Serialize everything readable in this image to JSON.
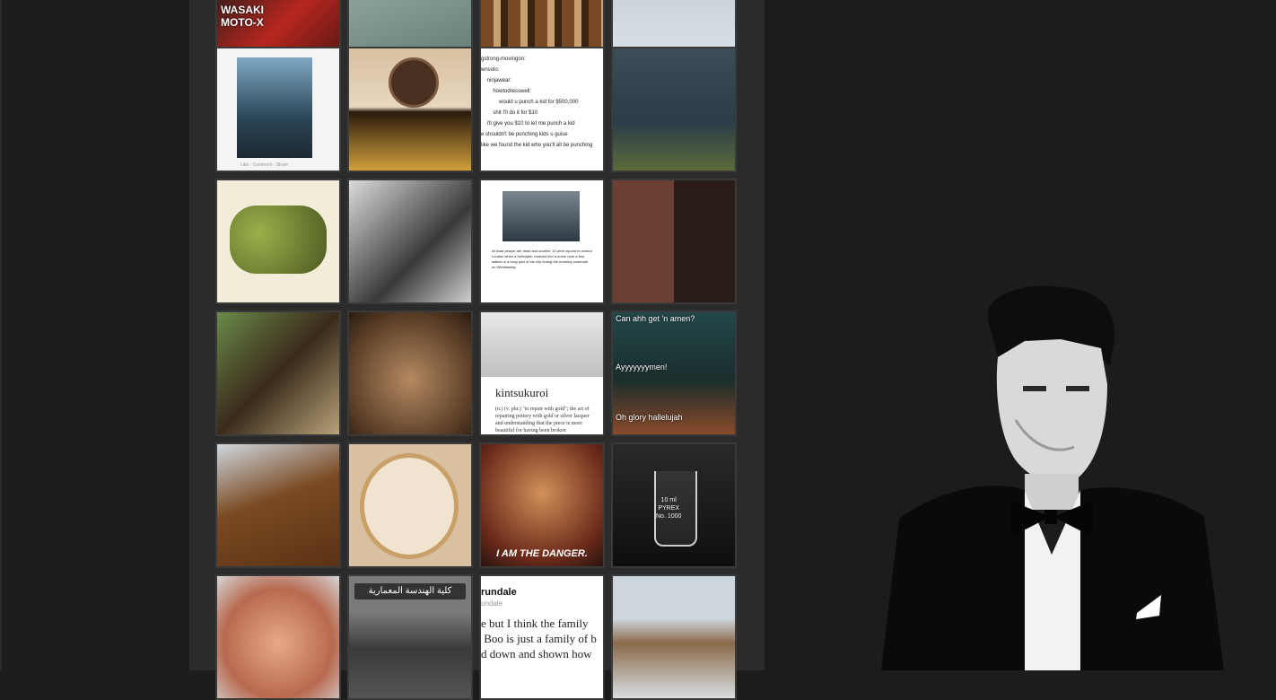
{
  "tiles": [
    {
      "id": "moto-x",
      "label": "WASAKI\nMOTO-X"
    },
    {
      "id": "water-stones",
      "label": ""
    },
    {
      "id": "rings-wood",
      "label": ""
    },
    {
      "id": "geese-sky",
      "label": ""
    },
    {
      "id": "police-car",
      "label": "Like · Comment · Share"
    },
    {
      "id": "angry-bird",
      "label": ""
    },
    {
      "id": "tumblr-text",
      "label": "gstrong-movingon:\nwnsolo:\n    ninjawear:\n        howtodresswell:\n            would u punch a kid for $500,000\n        shit I'll do it for $10\n    i'll give you $10 to let me punch a kid\ne shouldn't be punching kids u guise\nlike we found the kid who you'll all be punching"
    },
    {
      "id": "lake-aerial",
      "label": ""
    },
    {
      "id": "zelda-controller",
      "label": ""
    },
    {
      "id": "bw-portrait",
      "label": ""
    },
    {
      "id": "news-article",
      "label": "At least people are dead and another 13 were injured in central London when a helicopter crashed into a crane near a bus station in a busy part of the city during the morning commute on Wednesday."
    },
    {
      "id": "picard-facepalm",
      "label": ""
    },
    {
      "id": "dog-woman",
      "label": ""
    },
    {
      "id": "kitten",
      "label": ""
    },
    {
      "id": "kintsukuroi",
      "title": "kintsukuroi",
      "definition": "(n.) (v. phr.) \"to repair with gold\"; the art of repairing pottery with gold or silver lacquer and understanding that the piece is more beautiful for having been broken"
    },
    {
      "id": "voldemort",
      "top": "Can ahh get 'n amen?",
      "mid": "Ayyyyyyymen!",
      "bot": "Oh glory hallelujah"
    },
    {
      "id": "dachshund",
      "label": ""
    },
    {
      "id": "embroidery",
      "label": ""
    },
    {
      "id": "danger",
      "caption": "I AM THE DANGER."
    },
    {
      "id": "beaker",
      "label": "10 ml\nPYREX\nNo. 1000"
    },
    {
      "id": "paula",
      "label": ""
    },
    {
      "id": "school-sign",
      "label": "كلية الهندسة المعمارية"
    },
    {
      "id": "arundale",
      "name": "rundale",
      "sub": "undale",
      "text": "e but I think the family\n Boo is just a family of b\nd down and shown how"
    },
    {
      "id": "canal",
      "label": ""
    }
  ]
}
